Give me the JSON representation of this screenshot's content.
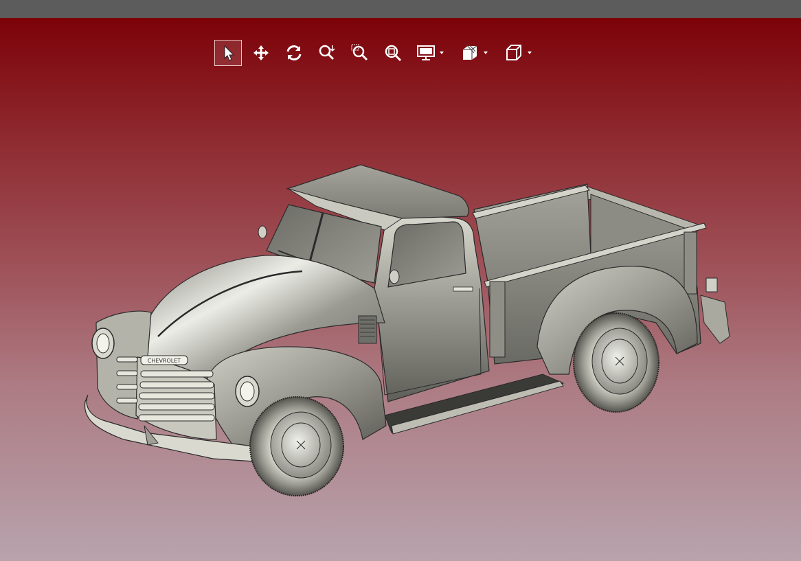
{
  "window": {
    "titlebar_color": "#5c5c5c"
  },
  "viewport": {
    "background_top": "#7c0208",
    "background_bottom": "#b8a3ad",
    "model": {
      "grille_badge_text": "CHEVROLET"
    }
  },
  "toolbar": {
    "tools": [
      {
        "name": "select-tool",
        "icon": "arrow-cursor-icon",
        "active": true
      },
      {
        "name": "pan-tool",
        "icon": "move-arrows-icon",
        "active": false
      },
      {
        "name": "rotate-tool",
        "icon": "rotate-icon",
        "active": false
      },
      {
        "name": "zoom-tool",
        "icon": "zoom-icon",
        "active": false
      },
      {
        "name": "zoom-window-tool",
        "icon": "zoom-window-icon",
        "active": false
      },
      {
        "name": "zoom-fit-tool",
        "icon": "zoom-fit-icon",
        "active": false
      },
      {
        "name": "display-mode-tool",
        "icon": "monitor-icon",
        "dropdown": true
      },
      {
        "name": "section-view-tool",
        "icon": "section-cube-icon",
        "dropdown": true
      },
      {
        "name": "view-orientation-tool",
        "icon": "cube-icon",
        "dropdown": true
      }
    ]
  }
}
